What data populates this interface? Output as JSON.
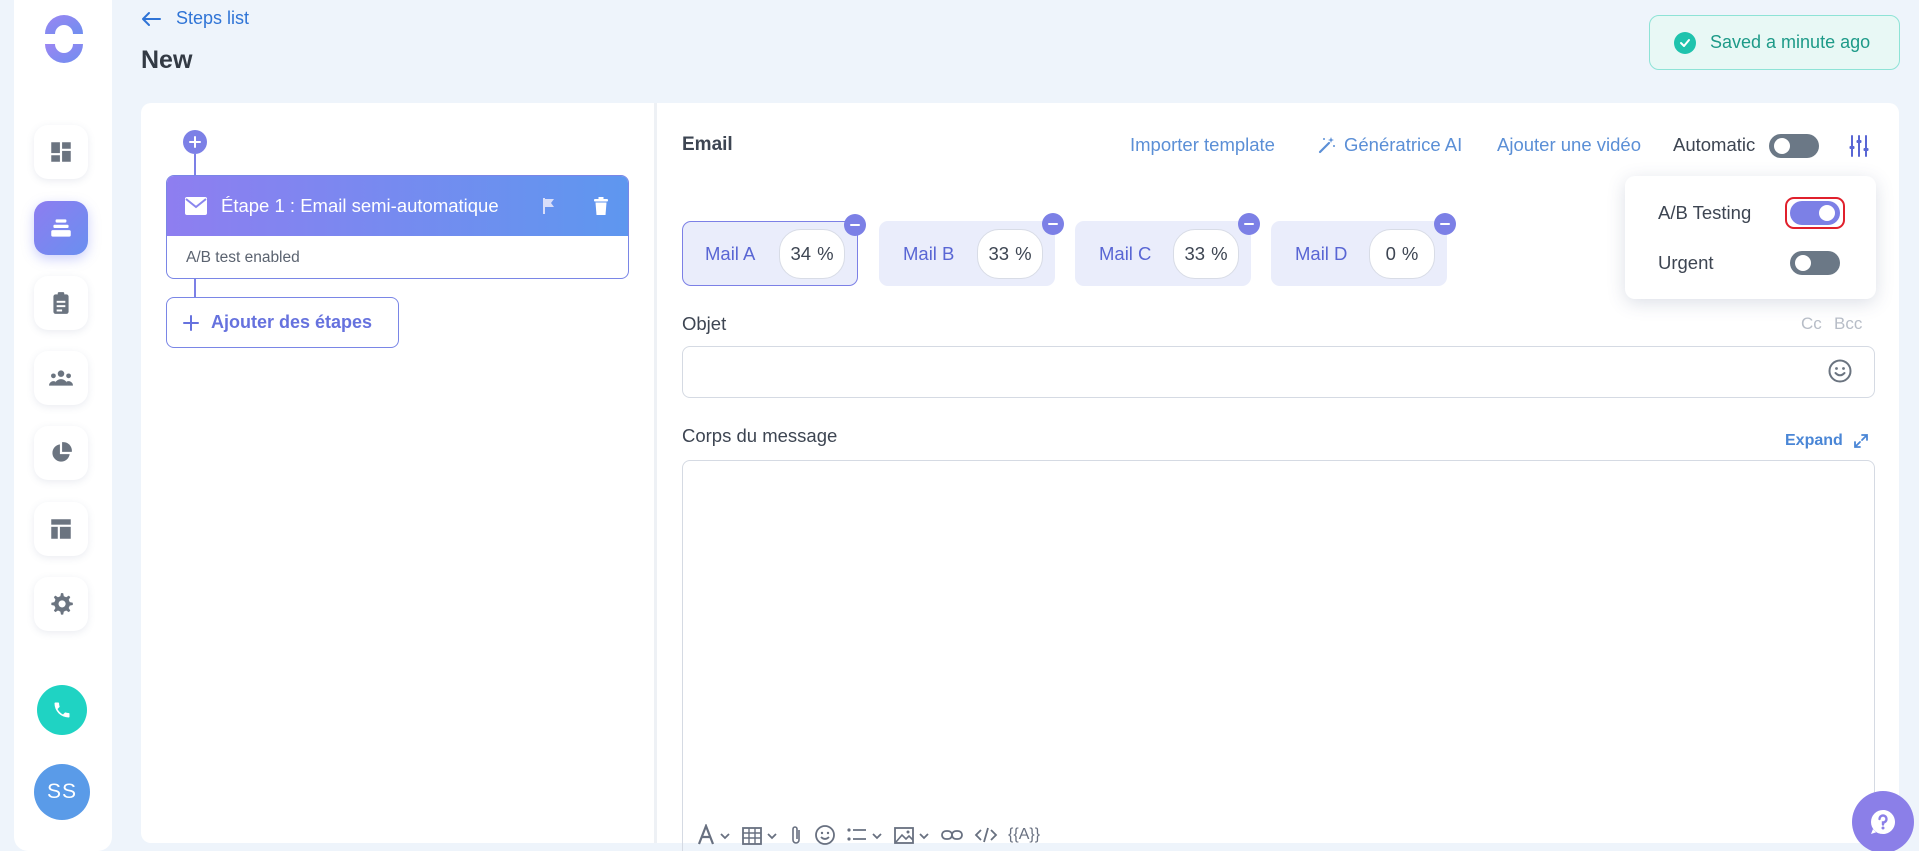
{
  "header": {
    "back_label": "Steps list",
    "page_title": "New",
    "saved_status": "Saved a minute ago"
  },
  "sidebar": {
    "items": [
      {
        "icon": "dashboard-icon",
        "active": false
      },
      {
        "icon": "sequences-icon",
        "active": true
      },
      {
        "icon": "clipboard-icon",
        "active": false
      },
      {
        "icon": "team-icon",
        "active": false
      },
      {
        "icon": "pie-chart-icon",
        "active": false
      },
      {
        "icon": "layout-icon",
        "active": false
      },
      {
        "icon": "gear-icon",
        "active": false
      }
    ],
    "avatar_initials": "SS"
  },
  "steps": {
    "items": [
      {
        "title": "Étape 1 : Email semi-automatique",
        "subtitle": "A/B test enabled"
      }
    ],
    "add_label": "Ajouter des étapes"
  },
  "email": {
    "section_label": "Email",
    "import_template": "Importer template",
    "ai_generator": "Génératrice AI",
    "add_video": "Ajouter une vidéo",
    "automatic_label": "Automatic",
    "automatic_on": false,
    "variants": [
      {
        "name": "Mail A",
        "percent": "34",
        "active": true
      },
      {
        "name": "Mail B",
        "percent": "33",
        "active": false
      },
      {
        "name": "Mail C",
        "percent": "33",
        "active": false
      },
      {
        "name": "Mail D",
        "percent": "0",
        "active": false
      }
    ],
    "percent_symbol": "%",
    "options": {
      "ab_testing_label": "A/B Testing",
      "ab_testing_on": true,
      "urgent_label": "Urgent",
      "urgent_on": false
    },
    "subject_label": "Objet",
    "subject_value": "",
    "cc_label": "Cc",
    "bcc_label": "Bcc",
    "body_label": "Corps du message",
    "expand_label": "Expand",
    "body_value": "",
    "toolbar": {
      "variables_label": "{{A}}"
    }
  },
  "colors": {
    "accent": "#7c80e6",
    "link": "#5b8fd6",
    "success": "#1fc3ad",
    "phone": "#1fd3c3"
  }
}
